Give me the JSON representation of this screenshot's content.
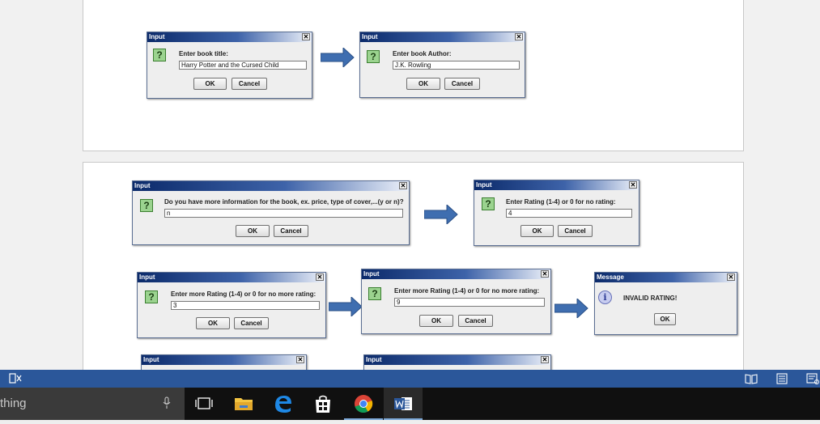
{
  "dialogs": {
    "title_input": "Input",
    "title_message": "Message",
    "close_glyph": "✕",
    "ok": "OK",
    "cancel": "Cancel",
    "d1": {
      "prompt": "Enter book title:",
      "value": "Harry Potter and the Cursed Child"
    },
    "d2": {
      "prompt": "Enter book Author:",
      "value": "J.K. Rowling"
    },
    "d3": {
      "prompt": "Do you have more information for the book, ex. price, type of cover,...(y or n)?",
      "value": "n"
    },
    "d4": {
      "prompt": "Enter Rating (1-4) or 0 for no rating:",
      "value": "4"
    },
    "d5": {
      "prompt": "Enter more Rating (1-4) or 0 for no more rating:",
      "value": "3"
    },
    "d6": {
      "prompt": "Enter more Rating (1-4) or 0 for no more rating:",
      "value": "9"
    },
    "d7": {
      "message": "INVALID RATING!"
    }
  },
  "taskbar": {
    "search_text": "thing"
  },
  "colors": {
    "word_status_bar": "#2b579a",
    "arrow_fill": "#3f6eb0"
  },
  "icons": {
    "question": "?",
    "info": "i"
  }
}
